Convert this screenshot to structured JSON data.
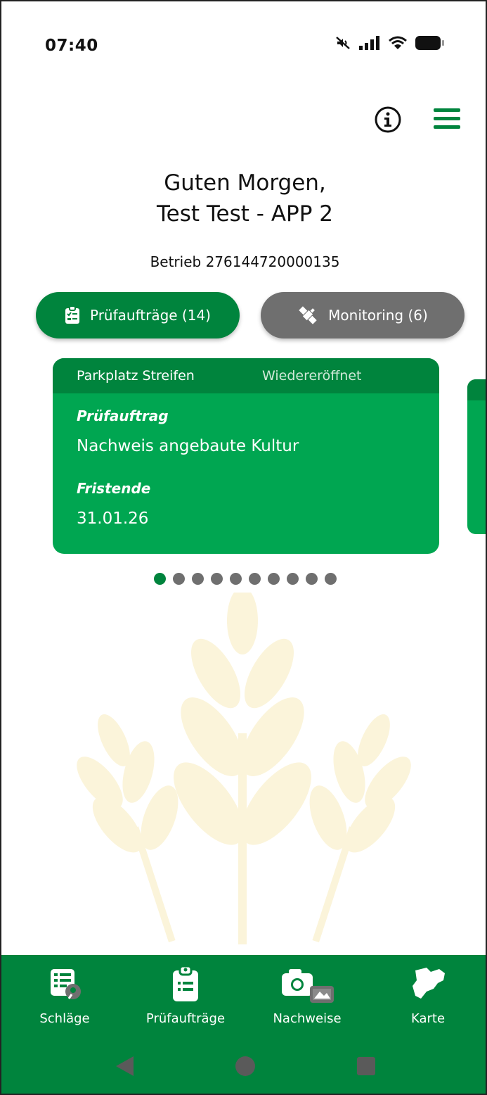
{
  "status_bar": {
    "time": "07:40"
  },
  "header": {
    "greeting_line1": "Guten Morgen,",
    "greeting_line2": "Test Test - APP 2",
    "betrieb": "Betrieb 276144720000135"
  },
  "toggles": {
    "pruefauftraege": "Prüfaufträge (14)",
    "monitoring": "Monitoring (6)"
  },
  "card": {
    "field_name": "Parkplatz Streifen",
    "status": "Wiedereröffnet",
    "label_auftrag": "Prüfauftrag",
    "auftrag": "Nachweis angebaute Kultur",
    "label_fristende": "Fristende",
    "fristende": "31.01.26"
  },
  "pagination": {
    "total": 10,
    "active_index": 0
  },
  "bottom_nav": {
    "items": [
      {
        "label": "Schläge",
        "icon": "fields-list-icon"
      },
      {
        "label": "Prüfaufträge",
        "icon": "clipboard-icon"
      },
      {
        "label": "Nachweise",
        "icon": "camera-gallery-icon"
      },
      {
        "label": "Karte",
        "icon": "saxony-map-icon"
      }
    ]
  },
  "colors": {
    "primary": "#00843d",
    "card_green": "#00a651",
    "inactive_gray": "#6f6f6f",
    "wheat": "#fbf4da"
  }
}
